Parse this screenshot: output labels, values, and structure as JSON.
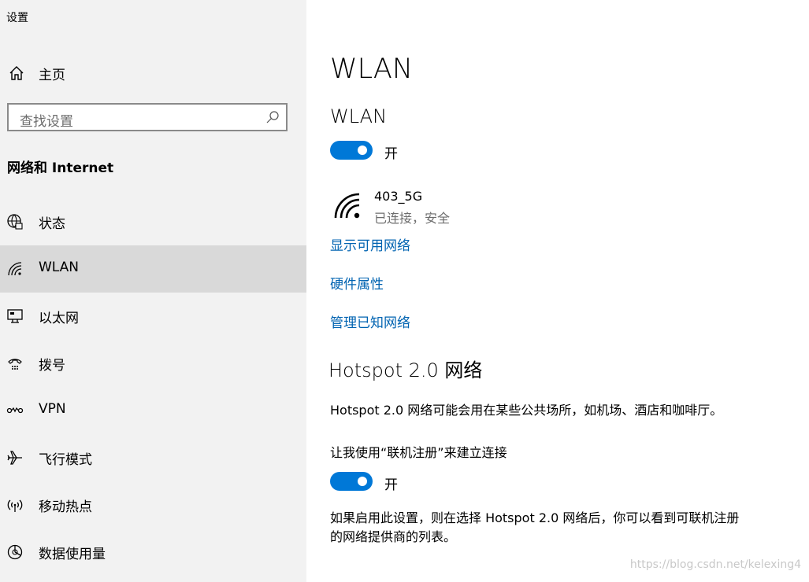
{
  "app": {
    "title": "设置"
  },
  "sidebar": {
    "home_label": "主页",
    "search_placeholder": "查找设置",
    "section_title": "网络和 Internet",
    "items": [
      {
        "label": "状态",
        "icon": "globe-status-icon"
      },
      {
        "label": "WLAN",
        "icon": "wifi-icon",
        "selected": true
      },
      {
        "label": "以太网",
        "icon": "ethernet-icon"
      },
      {
        "label": "拨号",
        "icon": "dialup-icon"
      },
      {
        "label": "VPN",
        "icon": "vpn-icon"
      },
      {
        "label": "飞行模式",
        "icon": "airplane-icon"
      },
      {
        "label": "移动热点",
        "icon": "hotspot-icon"
      },
      {
        "label": "数据使用量",
        "icon": "data-usage-icon"
      }
    ]
  },
  "main": {
    "title": "WLAN",
    "wlan_section_title": "WLAN",
    "wlan_toggle": {
      "state": "开",
      "on": true
    },
    "network": {
      "name": "403_5G",
      "status": "已连接，安全"
    },
    "links": {
      "show_available": "显示可用网络",
      "hardware_props": "硬件属性",
      "manage_known": "管理已知网络"
    },
    "hotspot": {
      "title": "Hotspot 2.0 网络",
      "desc": "Hotspot 2.0 网络可能会用在某些公共场所，如机场、酒店和咖啡厅。",
      "option_label": "让我使用“联机注册”来建立连接",
      "toggle": {
        "state": "开",
        "on": true
      },
      "note_line1": "如果启用此设置，则在选择 Hotspot 2.0 网络后，你可以看到可联机注册",
      "note_line2": "的网络提供商的列表。"
    }
  },
  "watermark": "https://blog.csdn.net/kelexing4",
  "colors": {
    "accent": "#0078d7",
    "link": "#0063b1",
    "sidebar_bg": "#f2f2f2",
    "selected_bg": "#d9d9d9"
  }
}
